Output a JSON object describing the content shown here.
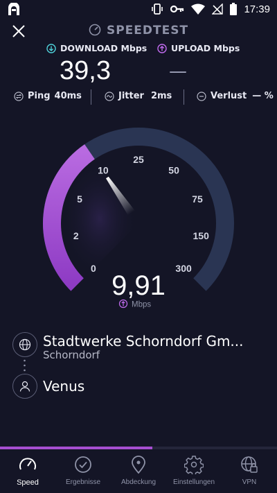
{
  "status_bar": {
    "time": "17:39",
    "icons": [
      "notification-app-icon",
      "vibrate-icon",
      "key-icon",
      "wifi-icon",
      "no-signal-icon",
      "battery-icon"
    ]
  },
  "header": {
    "title": "SPEEDTEST",
    "close_icon": "close-icon"
  },
  "download": {
    "label": "DOWNLOAD Mbps",
    "value": "39,3"
  },
  "upload": {
    "label": "UPLOAD Mbps",
    "value": "—"
  },
  "stats": {
    "ping_label": "Ping",
    "ping_value": "40ms",
    "jitter_label": "Jitter",
    "jitter_value": "2ms",
    "loss_label": "Verlust",
    "loss_value": "— %"
  },
  "gauge": {
    "ticks": [
      "0",
      "2",
      "5",
      "10",
      "25",
      "50",
      "75",
      "150",
      "300"
    ],
    "current_value": "9,91",
    "unit": "Mbps",
    "current_speed_mbps": 9.91,
    "colors": {
      "track": "#2a3553",
      "fill": "#a64ed0",
      "needle": "#ffffff"
    }
  },
  "provider": {
    "name": "Stadtwerke Schorndorf Gm...",
    "location": "Schorndorf"
  },
  "server": {
    "name": "Venus"
  },
  "progress": {
    "fraction": 0.55,
    "color": "#a64ed0"
  },
  "nav": [
    {
      "label": "Speed",
      "icon": "speedometer-icon",
      "active": true
    },
    {
      "label": "Ergebnisse",
      "icon": "check-circle-icon",
      "active": false
    },
    {
      "label": "Abdeckung",
      "icon": "map-pin-icon",
      "active": false
    },
    {
      "label": "Einstellungen",
      "icon": "gear-icon",
      "active": false
    },
    {
      "label": "VPN",
      "icon": "vpn-globe-icon",
      "active": false
    }
  ]
}
